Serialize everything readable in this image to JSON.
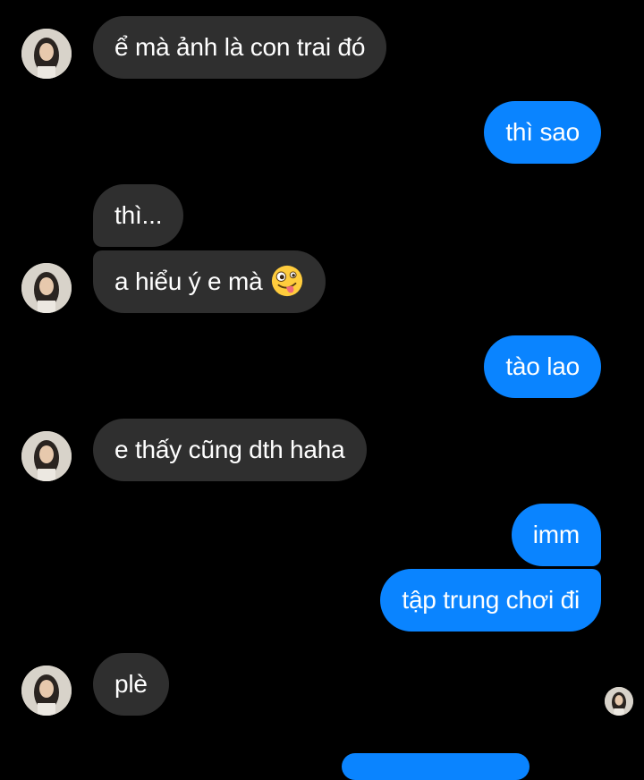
{
  "colors": {
    "background": "#000000",
    "incoming_bubble": "#2f2f2f",
    "outgoing_bubble": "#0a84ff",
    "text": "#ffffff"
  },
  "conversation": {
    "messages": [
      {
        "side": "incoming",
        "text": "ể mà ảnh là con trai đó"
      },
      {
        "side": "outgoing",
        "text": "thì sao"
      },
      {
        "side": "incoming",
        "text": "thì..."
      },
      {
        "side": "incoming",
        "text": "a hiểu ý e mà",
        "emoji": "crazy-face-emoji"
      },
      {
        "side": "outgoing",
        "text": "tào lao"
      },
      {
        "side": "incoming",
        "text": "e thấy cũng dth haha"
      },
      {
        "side": "outgoing",
        "text": "imm"
      },
      {
        "side": "outgoing",
        "text": "tập trung chơi đi"
      },
      {
        "side": "incoming",
        "text": "plè"
      }
    ],
    "contact_avatar": "contact-avatar-photo",
    "read_receipt": "read-receipt-avatar"
  }
}
